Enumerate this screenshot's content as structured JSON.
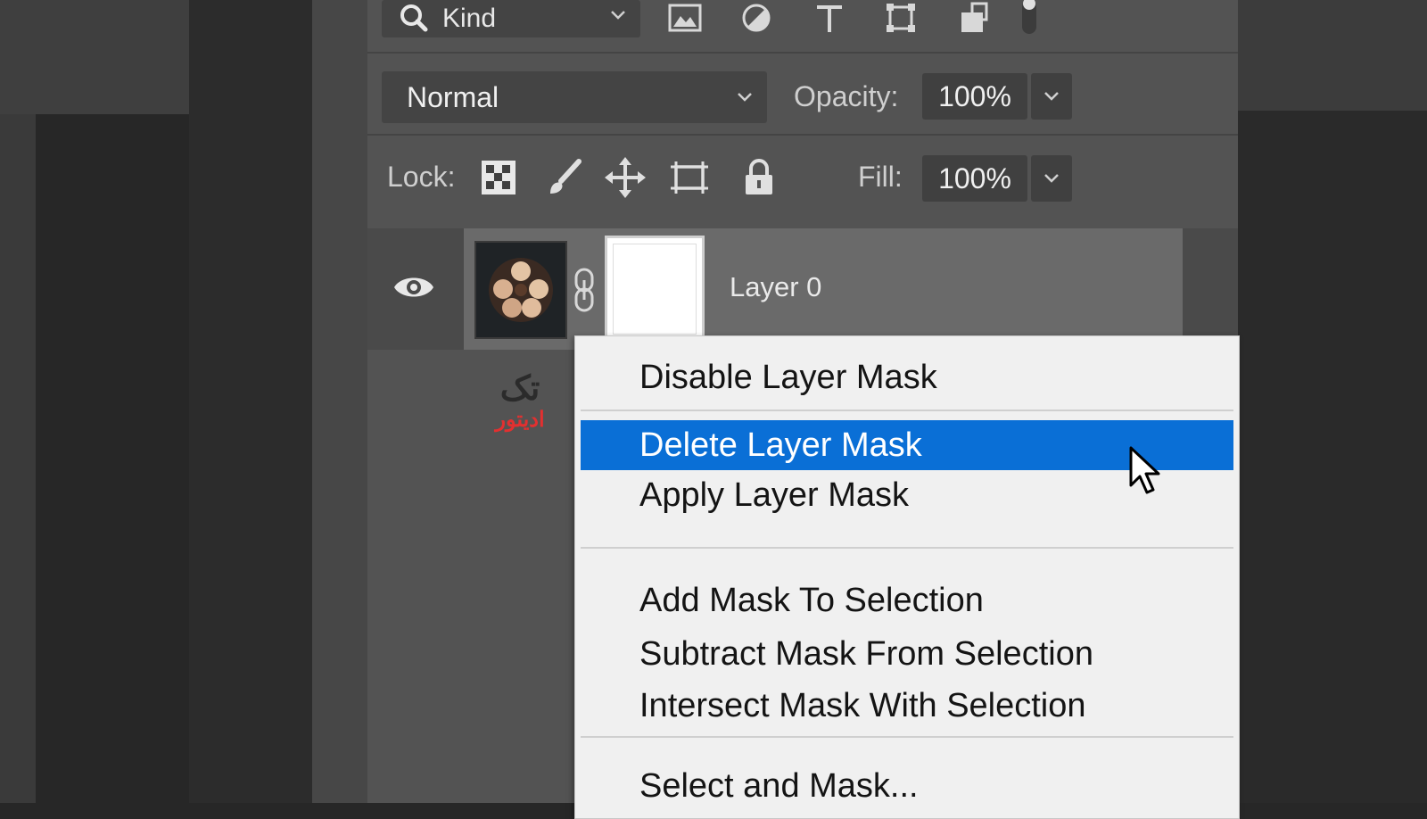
{
  "filter_bar": {
    "kind_label": "Kind",
    "filter_icons": [
      "image-filter-icon",
      "adjustment-filter-icon",
      "type-filter-icon",
      "shape-filter-icon",
      "smart-object-filter-icon"
    ]
  },
  "blend": {
    "mode": "Normal",
    "opacity_label": "Opacity:",
    "opacity_value": "100%"
  },
  "lock": {
    "label": "Lock:",
    "icons": [
      "lock-transparent-pixels-icon",
      "lock-image-pixels-icon",
      "lock-position-icon",
      "lock-artboard-icon",
      "lock-all-icon"
    ],
    "fill_label": "Fill:",
    "fill_value": "100%"
  },
  "layer": {
    "name": "Layer 0"
  },
  "watermark": {
    "line1": "تک",
    "line2": "ادیتور"
  },
  "context_menu": {
    "items": [
      {
        "label": "Disable Layer Mask",
        "highlighted": false
      },
      {
        "label": "Delete Layer Mask",
        "highlighted": true
      },
      {
        "label": "Apply Layer Mask",
        "highlighted": false
      },
      {
        "label": "Add Mask To Selection",
        "highlighted": false
      },
      {
        "label": "Subtract Mask From Selection",
        "highlighted": false
      },
      {
        "label": "Intersect Mask With Selection",
        "highlighted": false
      },
      {
        "label": "Select and Mask...",
        "highlighted": false
      }
    ]
  },
  "colors": {
    "highlight": "#0a6fd6",
    "panel_bg": "#535353",
    "menu_bg": "#f0f0f0"
  }
}
